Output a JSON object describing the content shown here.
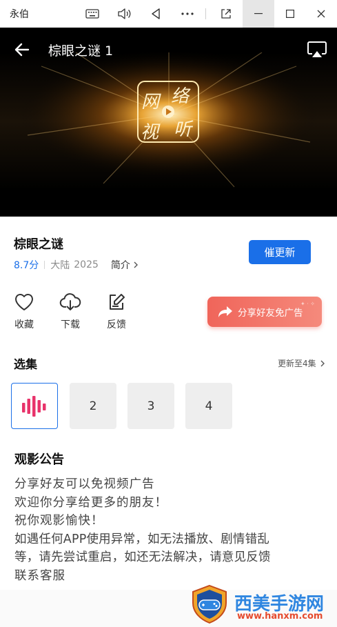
{
  "window": {
    "title": "永伯"
  },
  "player": {
    "title": "棕眼之谜 1",
    "logo_text": "网络视听"
  },
  "show": {
    "title": "棕眼之谜",
    "rating": "8.7分",
    "region": "大陆",
    "year": "2025",
    "intro_label": "简介",
    "update_button": "催更新"
  },
  "actions": {
    "favorite": "收藏",
    "download": "下载",
    "feedback": "反馈",
    "share": "分享好友免广告"
  },
  "episodes": {
    "section_title": "选集",
    "update_status": "更新至4集",
    "items": [
      "2",
      "3",
      "4"
    ]
  },
  "notice": {
    "title": "观影公告",
    "lines": [
      "分享好友可以免视频广告",
      "欢迎你分享给更多的朋友！",
      "祝你观影愉快！",
      "如遇任何APP使用异常，如无法播放、剧情错乱",
      "等，请先尝试重启，如还无法解决，请意见反馈",
      "联系客服"
    ]
  },
  "watermark": {
    "site_name": "西美手游网",
    "url": "www.hanxm.com"
  },
  "colors": {
    "accent": "#1a6fe8",
    "share_gradient_start": "#f0655a",
    "share_gradient_end": "#f58a7c",
    "playing_bars": "#e8336b"
  }
}
